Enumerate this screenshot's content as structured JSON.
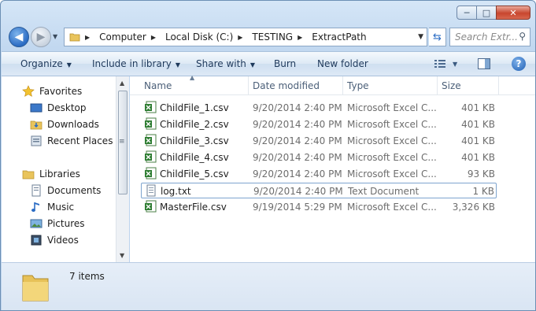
{
  "window": {
    "caption": {
      "minimize": "─",
      "maximize": "□",
      "close": "✕"
    }
  },
  "address": {
    "crumbs": [
      "Computer",
      "Local Disk (C:)",
      "TESTING",
      "ExtractPath"
    ]
  },
  "search": {
    "placeholder": "Search Extr..."
  },
  "toolbar": {
    "organize": "Organize",
    "include_in_library": "Include in library",
    "share_with": "Share with",
    "burn": "Burn",
    "new_folder": "New folder",
    "help": "?"
  },
  "sidebar": {
    "favorites_label": "Favorites",
    "favorites": [
      {
        "label": "Desktop"
      },
      {
        "label": "Downloads"
      },
      {
        "label": "Recent Places"
      }
    ],
    "libraries_label": "Libraries",
    "libraries": [
      {
        "label": "Documents"
      },
      {
        "label": "Music"
      },
      {
        "label": "Pictures"
      },
      {
        "label": "Videos"
      }
    ]
  },
  "columns": {
    "name": "Name",
    "date_modified": "Date modified",
    "type": "Type",
    "size": "Size"
  },
  "files": [
    {
      "name": "ChildFile_1.csv",
      "date": "9/20/2014 2:40 PM",
      "type": "Microsoft Excel C...",
      "size": "401 KB",
      "icon": "excel-csv-icon"
    },
    {
      "name": "ChildFile_2.csv",
      "date": "9/20/2014 2:40 PM",
      "type": "Microsoft Excel C...",
      "size": "401 KB",
      "icon": "excel-csv-icon"
    },
    {
      "name": "ChildFile_3.csv",
      "date": "9/20/2014 2:40 PM",
      "type": "Microsoft Excel C...",
      "size": "401 KB",
      "icon": "excel-csv-icon"
    },
    {
      "name": "ChildFile_4.csv",
      "date": "9/20/2014 2:40 PM",
      "type": "Microsoft Excel C...",
      "size": "401 KB",
      "icon": "excel-csv-icon"
    },
    {
      "name": "ChildFile_5.csv",
      "date": "9/20/2014 2:40 PM",
      "type": "Microsoft Excel C...",
      "size": "93 KB",
      "icon": "excel-csv-icon"
    },
    {
      "name": "log.txt",
      "date": "9/20/2014 2:40 PM",
      "type": "Text Document",
      "size": "1 KB",
      "icon": "text-file-icon"
    },
    {
      "name": "MasterFile.csv",
      "date": "9/19/2014 5:29 PM",
      "type": "Microsoft Excel C...",
      "size": "3,326 KB",
      "icon": "excel-csv-icon"
    }
  ],
  "status": {
    "item_count": "7 items"
  }
}
